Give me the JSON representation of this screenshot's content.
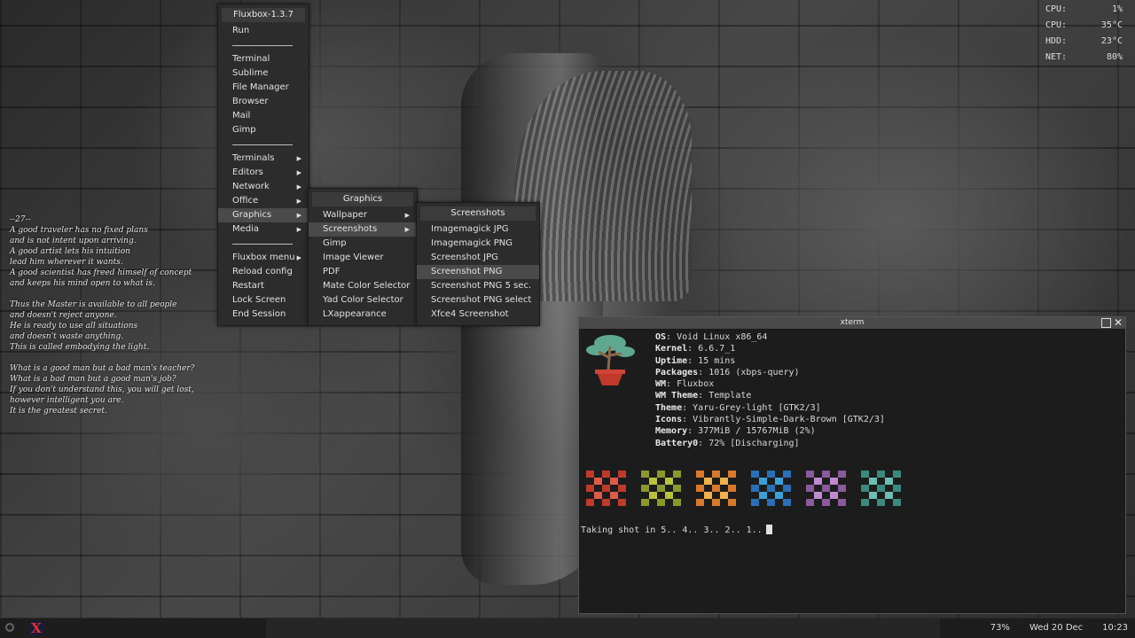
{
  "sysmon": [
    {
      "label": "CPU:",
      "value": "1%"
    },
    {
      "label": "CPU:",
      "value": "35°C"
    },
    {
      "label": "HDD:",
      "value": "23°C"
    },
    {
      "label": "NET:",
      "value": "80%"
    }
  ],
  "poem": {
    "lines": [
      "--27--",
      "A good traveler has no fixed plans",
      "and is not intent upon arriving.",
      "A good artist lets his intuition",
      "lead him wherever it wants.",
      "A good scientist has freed himself of concept",
      "and keeps his mind open to what is.",
      "",
      "Thus the Master is available to all people",
      "and doesn't reject anyone.",
      "He is ready to use all situations",
      "and doesn't waste anything.",
      "This is called embodying the light.",
      "",
      "What is a good man but a bad man's teacher?",
      "What is a bad man but a good man's job?",
      "If you don't understand this, you will get lost,",
      "however intelligent you are.",
      "It is the greatest secret."
    ]
  },
  "root_menu": {
    "title": "Fluxbox-1.3.7",
    "run": "Run",
    "apps": [
      "Terminal",
      "Sublime",
      "File Manager",
      "Browser",
      "Mail",
      "Gimp"
    ],
    "submenus": [
      "Terminals",
      "Editors",
      "Network",
      "Office",
      "Graphics",
      "Media"
    ],
    "system_menu": "Fluxbox menu",
    "system": [
      "Reload config",
      "Restart",
      "Lock Screen",
      "End Session"
    ],
    "arrow": "▶"
  },
  "graphics_menu": {
    "title": "Graphics",
    "items": [
      "Wallpaper",
      "Screenshots",
      "Gimp",
      "Image Viewer",
      "PDF",
      "Mate Color Selector",
      "Yad Color Selector",
      "LXappearance"
    ]
  },
  "screenshots_menu": {
    "title": "Screenshots",
    "items": [
      "Imagemagick JPG",
      "Imagemagick PNG",
      "Screenshot JPG",
      "Screenshot PNG",
      "Screenshot PNG 5 sec.",
      "Screenshot PNG select",
      "Xfce4 Screenshot"
    ]
  },
  "xterm": {
    "title": "xterm",
    "info": [
      {
        "key": "OS",
        "value": "Void Linux x86_64"
      },
      {
        "key": "Kernel",
        "value": "6.6.7_1"
      },
      {
        "key": "Uptime",
        "value": "15 mins"
      },
      {
        "key": "Packages",
        "value": "1016 (xbps-query)"
      },
      {
        "key": "WM",
        "value": "Fluxbox"
      },
      {
        "key": "WM Theme",
        "value": "Template"
      },
      {
        "key": "Theme",
        "value": "Yaru-Grey-light [GTK2/3]"
      },
      {
        "key": "Icons",
        "value": "Vibrantly-Simple-Dark-Brown [GTK2/3]"
      },
      {
        "key": "Memory",
        "value": "377MiB / 15767MiB (2%)"
      },
      {
        "key": "Battery0",
        "value": "72% [Discharging]"
      }
    ],
    "palette": [
      [
        "#c0392b",
        "#e05a4a"
      ],
      [
        "#8a9a2a",
        "#b8c23a"
      ],
      [
        "#d9792a",
        "#f2b04a"
      ],
      [
        "#2a6fb8",
        "#3aa0d8"
      ],
      [
        "#8a5a9a",
        "#c08ad0"
      ],
      [
        "#3a8a80",
        "#6ac0b0"
      ]
    ],
    "prompt": "Taking shot in 5.. 4.. 3.. 2.. 1.."
  },
  "taskbar": {
    "battery": "73%",
    "date": "Wed 20 Dec",
    "time": "10:23",
    "logo_letter": "X"
  }
}
